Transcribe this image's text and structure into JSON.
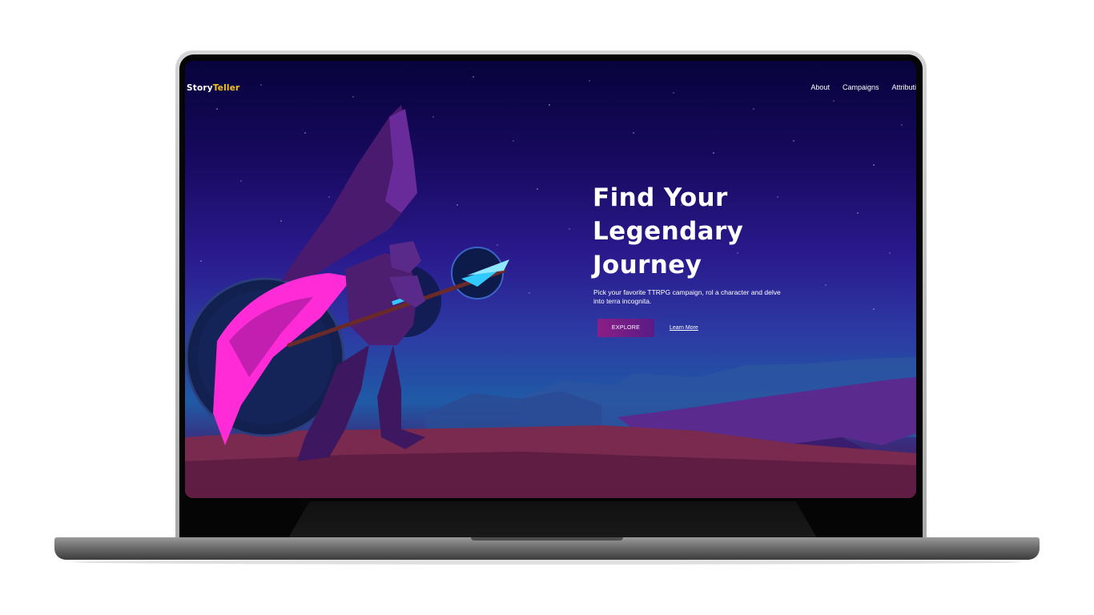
{
  "nav": {
    "logo_part1": "Story",
    "logo_part2": "Teller",
    "links": [
      "About",
      "Campaigns",
      "Attributi"
    ]
  },
  "hero": {
    "title_line1": "Find Your",
    "title_line2": "Legendary Journey",
    "subtitle": "Pick your favorite TTRPG campaign, rol a character and delve into terra incognita.",
    "explore_label": "EXPLORE",
    "learn_more_label": "Learn More"
  },
  "colors": {
    "logo_accent": "#f5c518",
    "button_gradient_start": "#8a1f86",
    "button_gradient_end": "#5b1a86",
    "sky_top": "#07033b",
    "sky_mid": "#2a1a8e",
    "cape_pink": "#ff2bd6"
  },
  "icons": {
    "illustration": "warrior-with-spear-illustration"
  }
}
